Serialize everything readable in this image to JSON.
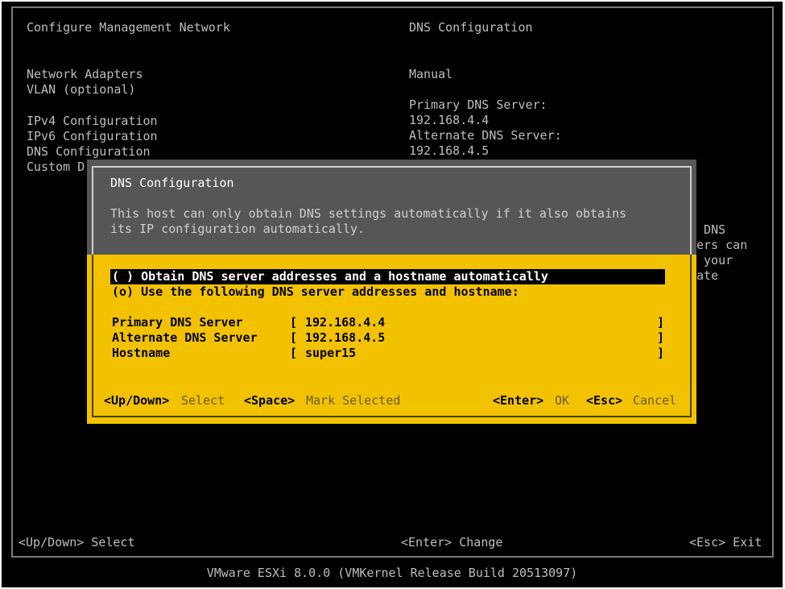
{
  "main": {
    "title": "Configure Management Network",
    "right_title": "DNS Configuration",
    "menu": [
      "Network Adapters",
      "VLAN (optional)",
      "IPv4 Configuration",
      "IPv6 Configuration",
      "DNS Configuration",
      "Custom D"
    ],
    "info": {
      "mode": "Manual",
      "primary_label": "Primary DNS Server:",
      "primary_value": "192.168.4.4",
      "alternate_label": "Alternate DNS Server:",
      "alternate_value": "192.168.4.5"
    },
    "partial_lines": [
      ", DNS",
      "ters can",
      "k your",
      "iate"
    ]
  },
  "dialog": {
    "title": "DNS Configuration",
    "description_line1": "This host can only obtain DNS settings automatically if it also obtains",
    "description_line2": "its IP configuration automatically.",
    "option_auto": "( ) Obtain DNS server addresses and a hostname automatically",
    "option_manual": "(o) Use the following DNS server addresses and hostname:",
    "fields": [
      {
        "label": "Primary DNS Server",
        "value": "192.168.4.4"
      },
      {
        "label": "Alternate DNS Server",
        "value": "192.168.4.5"
      },
      {
        "label": "Hostname",
        "value": "super15"
      }
    ],
    "bracket_open": "[",
    "bracket_close": "]",
    "hints": {
      "updown_key": "<Up/Down>",
      "updown_action": "Select",
      "space_key": "<Space>",
      "space_action": "Mark Selected",
      "enter_key": "<Enter>",
      "enter_action": "OK",
      "esc_key": "<Esc>",
      "esc_action": "Cancel"
    }
  },
  "bottom_hints": {
    "left": "<Up/Down> Select",
    "center": "<Enter> Change",
    "right": "<Esc> Exit"
  },
  "footer": "VMware ESXi 8.0.0 (VMKernel Release Build 20513097)",
  "colors": {
    "background": "#000000",
    "dialog_yellow": "#f2c200",
    "dialog_header_gray": "#565656",
    "text_gray": "#bdbdbd"
  }
}
